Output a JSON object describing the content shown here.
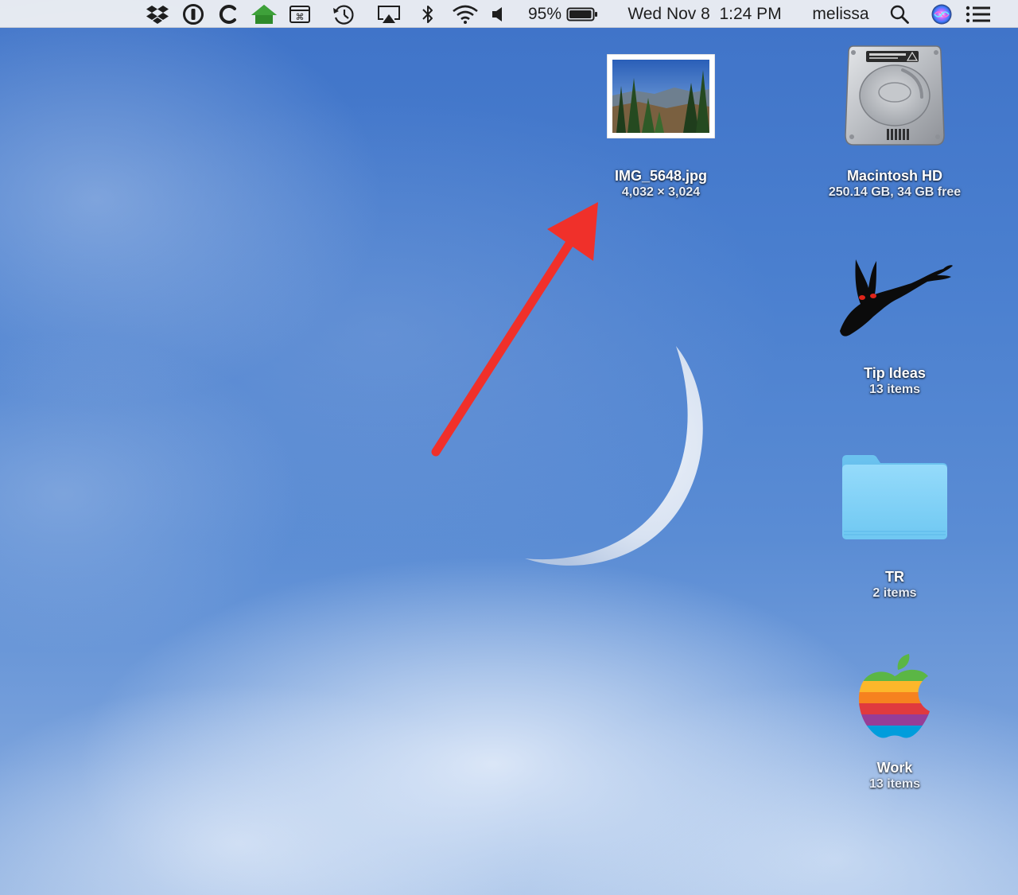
{
  "menubar": {
    "status_icons": [
      {
        "name": "dropbox-icon"
      },
      {
        "name": "1password-icon"
      },
      {
        "name": "cleanmymac-icon"
      },
      {
        "name": "home-icon"
      },
      {
        "name": "cheatsheet-icon"
      },
      {
        "name": "time-machine-icon"
      },
      {
        "name": "airplay-icon"
      },
      {
        "name": "bluetooth-icon"
      },
      {
        "name": "wifi-icon"
      },
      {
        "name": "volume-icon"
      }
    ],
    "battery_percent": "95%",
    "battery_level": 0.95,
    "datetime": "Wed Nov 8  1:24 PM",
    "user": "melissa",
    "search_icon": "spotlight-search-icon",
    "siri_icon": "siri-icon",
    "notification_icon": "notification-center-icon"
  },
  "desktop": {
    "items": [
      {
        "name": "IMG_5648.jpg",
        "info": "4,032 × 3,024",
        "kind": "image-file"
      },
      {
        "name": "Macintosh HD",
        "info": "250.14 GB, 34 GB free",
        "kind": "hard-drive"
      },
      {
        "name": "Tip Ideas",
        "info": "13 items",
        "kind": "folder-custom-rabbit"
      },
      {
        "name": "TR",
        "info": "2 items",
        "kind": "folder"
      },
      {
        "name": "Work",
        "info": "13 items",
        "kind": "folder-custom-apple"
      }
    ]
  },
  "annotation": {
    "type": "arrow",
    "color": "#f0302a"
  },
  "colors": {
    "menubar_bg": "#eceef3",
    "sky_blue": "#4a7fcf",
    "folder_blue": "#7fcff5",
    "arrow_red": "#f0302a"
  }
}
